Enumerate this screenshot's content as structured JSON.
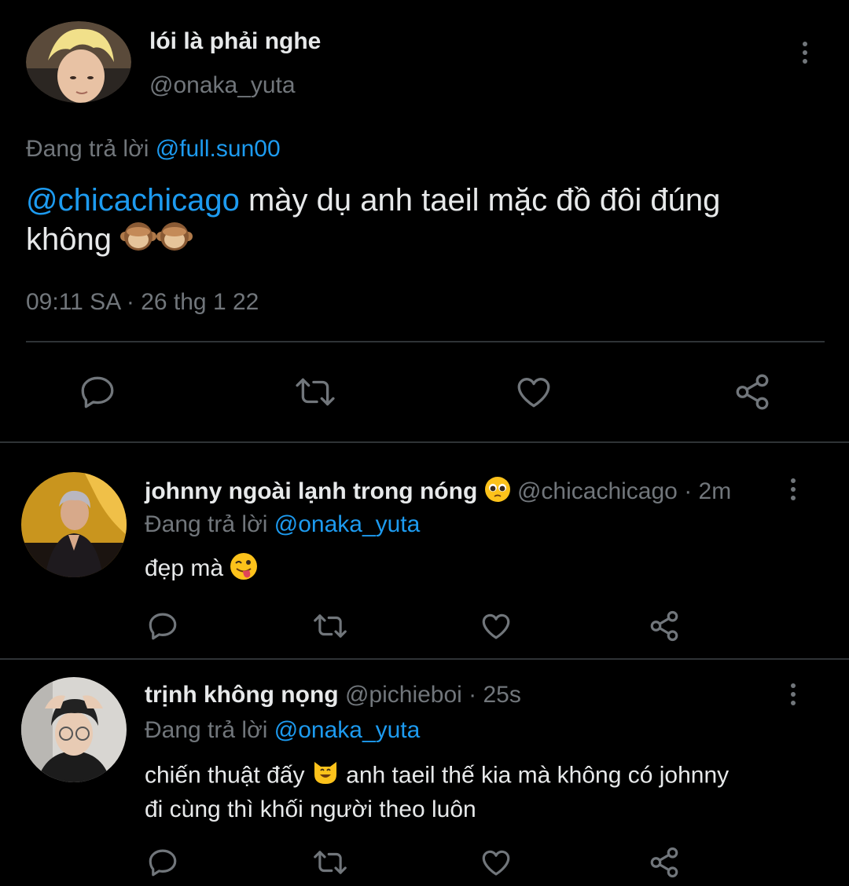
{
  "main_tweet": {
    "display_name": "lói là phải nghe",
    "handle": "@onaka_yuta",
    "reply_prefix": "Đang trả lời",
    "reply_to": "@full.sun00",
    "mention": "@chicachicago",
    "text_line1": "mày dụ anh taeil mặc đồ đôi đúng",
    "text_line2": "không",
    "emojis": [
      "see-no-evil-monkey",
      "see-no-evil-monkey"
    ],
    "timestamp": "09:11 SA · 26 thg 1 22"
  },
  "replies": [
    {
      "display_name": "johnny ngoài lạnh trong nóng",
      "name_emoji": "pleading-face",
      "handle": "@chicachicago",
      "time": "· 2m",
      "reply_prefix": "Đang trả lời",
      "reply_to": "@onaka_yuta",
      "text": "đẹp mà",
      "text_emoji": "winking-face-with-tongue"
    },
    {
      "display_name": "trịnh không nọng",
      "handle": "@pichieboi",
      "time": "· 25s",
      "reply_prefix": "Đang trả lời",
      "reply_to": "@onaka_yuta",
      "text_part1": "chiến thuật đấy",
      "text_emoji": "grinning-cat",
      "text_part2": "anh taeil thế kia mà không có johnny",
      "text_line2": "đi cùng thì khối người theo luôn"
    }
  ],
  "colors": {
    "background": "#000000",
    "text": "#e7e9ea",
    "muted": "#71767b",
    "link": "#1d9bf0",
    "divider": "#2f3336"
  }
}
